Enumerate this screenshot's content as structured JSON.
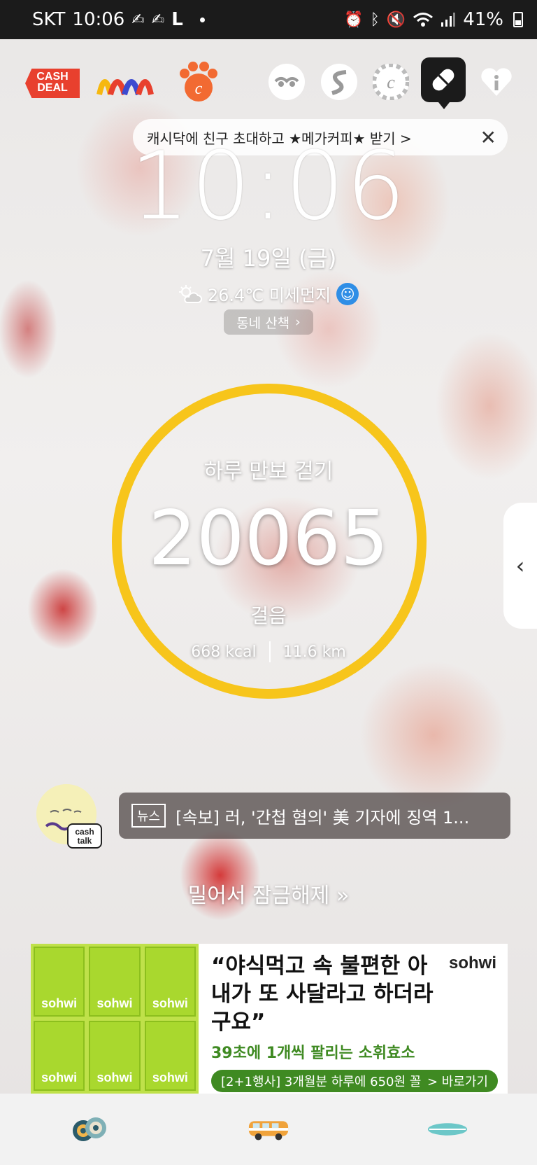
{
  "status_bar": {
    "carrier": "SKT",
    "time": "10:06",
    "letter_icon": "L",
    "battery": "41%",
    "icons": [
      "alarm-icon",
      "bluetooth-icon",
      "mute-icon",
      "wifi-icon",
      "signal-icon",
      "battery-icon"
    ]
  },
  "top_icons": {
    "cashdeal": "CASH\nDEAL",
    "items": [
      "cashdeal-app",
      "colorful-app",
      "paw-c-app",
      "face-app",
      "swirl-app",
      "coin-c-app",
      "pill-app",
      "heart-info-app"
    ]
  },
  "banner": {
    "text": "캐시닥에 친구 초대하고 ★메가커피★ 받기 >",
    "close": "✕"
  },
  "lock": {
    "time": "10:06",
    "date": "7월 19일 (금)",
    "weather": "26.4℃ 미세먼지",
    "walk_button": "동네 산책"
  },
  "steps": {
    "title": "하루 만보 걷기",
    "count": "20065",
    "unit": "걸음",
    "kcal": "668 kcal",
    "distance": "11.6 km",
    "ring_color": "#f7c51b"
  },
  "news": {
    "tag": "뉴스",
    "headline": "[속보] 러, '간첩 혐의' 美 기자에 징역 1..."
  },
  "cashtalk": {
    "label": "cash\ntalk"
  },
  "unlock_text": "밀어서 잠금해제",
  "ad": {
    "brand": "sohwi",
    "headline": "“야식먹고 속 불편한 아내가 또 사달라고 하더라구요”",
    "sub": "39초에 1개씩 팔리는 소휘효소",
    "cta_left": "[2+1행사] 3개월분 하루에 650원 꼴",
    "cta_right": "> 바로가기",
    "box_label": "sohwi"
  },
  "bottom_nav": [
    "eyes-icon",
    "van-icon",
    "surfboard-icon"
  ]
}
